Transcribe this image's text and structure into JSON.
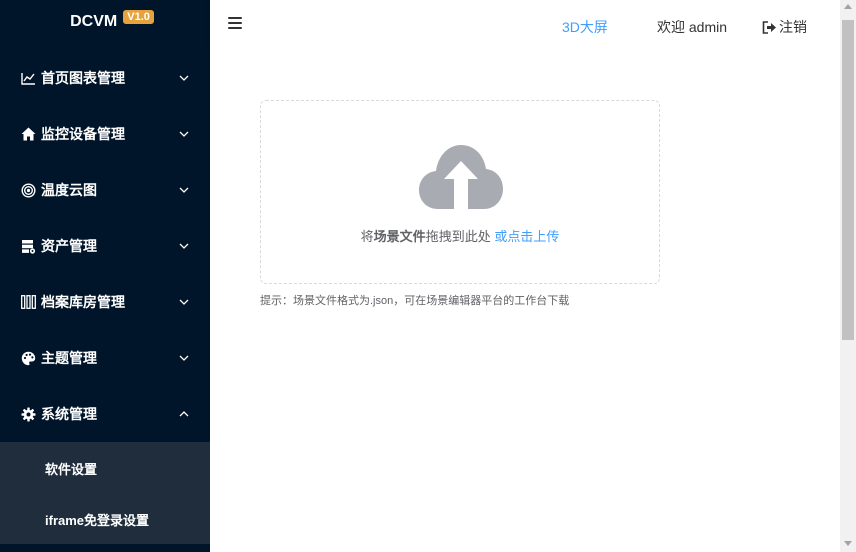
{
  "brand": {
    "name": "DCVM",
    "version": "V1.0"
  },
  "menu": [
    {
      "label": "首页图表管理",
      "icon": "line-chart-icon",
      "expanded": false
    },
    {
      "label": "监控设备管理",
      "icon": "home-icon",
      "expanded": false
    },
    {
      "label": "温度云图",
      "icon": "radar-icon",
      "expanded": false
    },
    {
      "label": "资产管理",
      "icon": "server-icon",
      "expanded": false
    },
    {
      "label": "档案库房管理",
      "icon": "archive-shelf-icon",
      "expanded": false
    },
    {
      "label": "主题管理",
      "icon": "palette-icon",
      "expanded": false
    },
    {
      "label": "系统管理",
      "icon": "gear-icon",
      "expanded": true
    }
  ],
  "submenu": {
    "items": [
      "软件设置",
      "iframe免登录设置"
    ]
  },
  "header": {
    "link_3d": "3D大屏",
    "welcome": "欢迎 admin",
    "logout": "注销"
  },
  "upload": {
    "text_prefix": "将",
    "text_bold": "场景文件",
    "text_middle": "拖拽到此处 ",
    "text_click": "或点击上传",
    "tip": "提示：场景文件格式为.json，可在场景编辑器平台的工作台下载"
  },
  "colors": {
    "sidebar_bg": "#001529",
    "submenu_bg": "#1f2d3d",
    "accent": "#409eff",
    "badge": "#e6a23c",
    "cloud_icon": "#a8abb2"
  }
}
